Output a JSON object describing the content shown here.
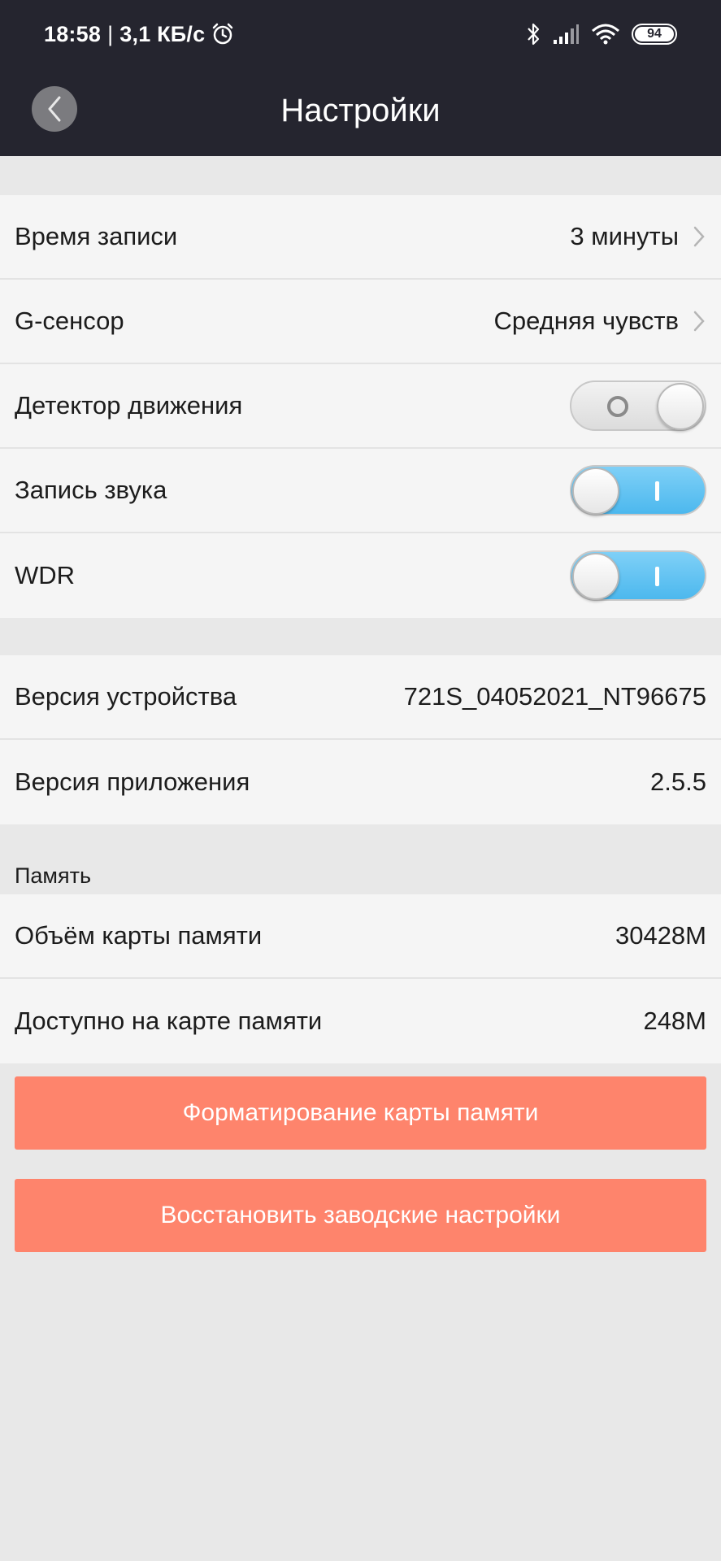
{
  "status_bar": {
    "time": "18:58",
    "separator": "|",
    "speed": "3,1 КБ/с",
    "battery": "94",
    "icons": [
      "alarm-icon",
      "bluetooth-icon",
      "signal-icon",
      "wifi-icon",
      "battery-icon"
    ]
  },
  "header": {
    "title": "Настройки",
    "back_icon": "chevron-left-icon"
  },
  "settings": {
    "record_time": {
      "label": "Время записи",
      "value": "3 минуты"
    },
    "g_sensor": {
      "label": "G-сенсор",
      "value": "Средняя чувств"
    },
    "motion_detector": {
      "label": "Детектор движения",
      "state": "off"
    },
    "sound_record": {
      "label": "Запись звука",
      "state": "on"
    },
    "wdr": {
      "label": "WDR",
      "state": "on"
    }
  },
  "versions": {
    "device": {
      "label": "Версия устройства",
      "value": "721S_04052021_NT96675"
    },
    "app": {
      "label": "Версия приложения",
      "value": "2.5.5"
    }
  },
  "memory": {
    "section_title": "Память",
    "capacity": {
      "label": "Объём карты памяти",
      "value": "30428M"
    },
    "available": {
      "label": "Доступно на карте памяти",
      "value": "248M"
    }
  },
  "actions": {
    "format": "Форматирование карты памяти",
    "reset": "Восстановить заводские настройки"
  },
  "colors": {
    "header_bg": "#25252f",
    "page_bg": "#e8e8e8",
    "row_bg": "#f5f5f5",
    "toggle_on": "#4cb8ee",
    "action_button": "#fe846c"
  }
}
